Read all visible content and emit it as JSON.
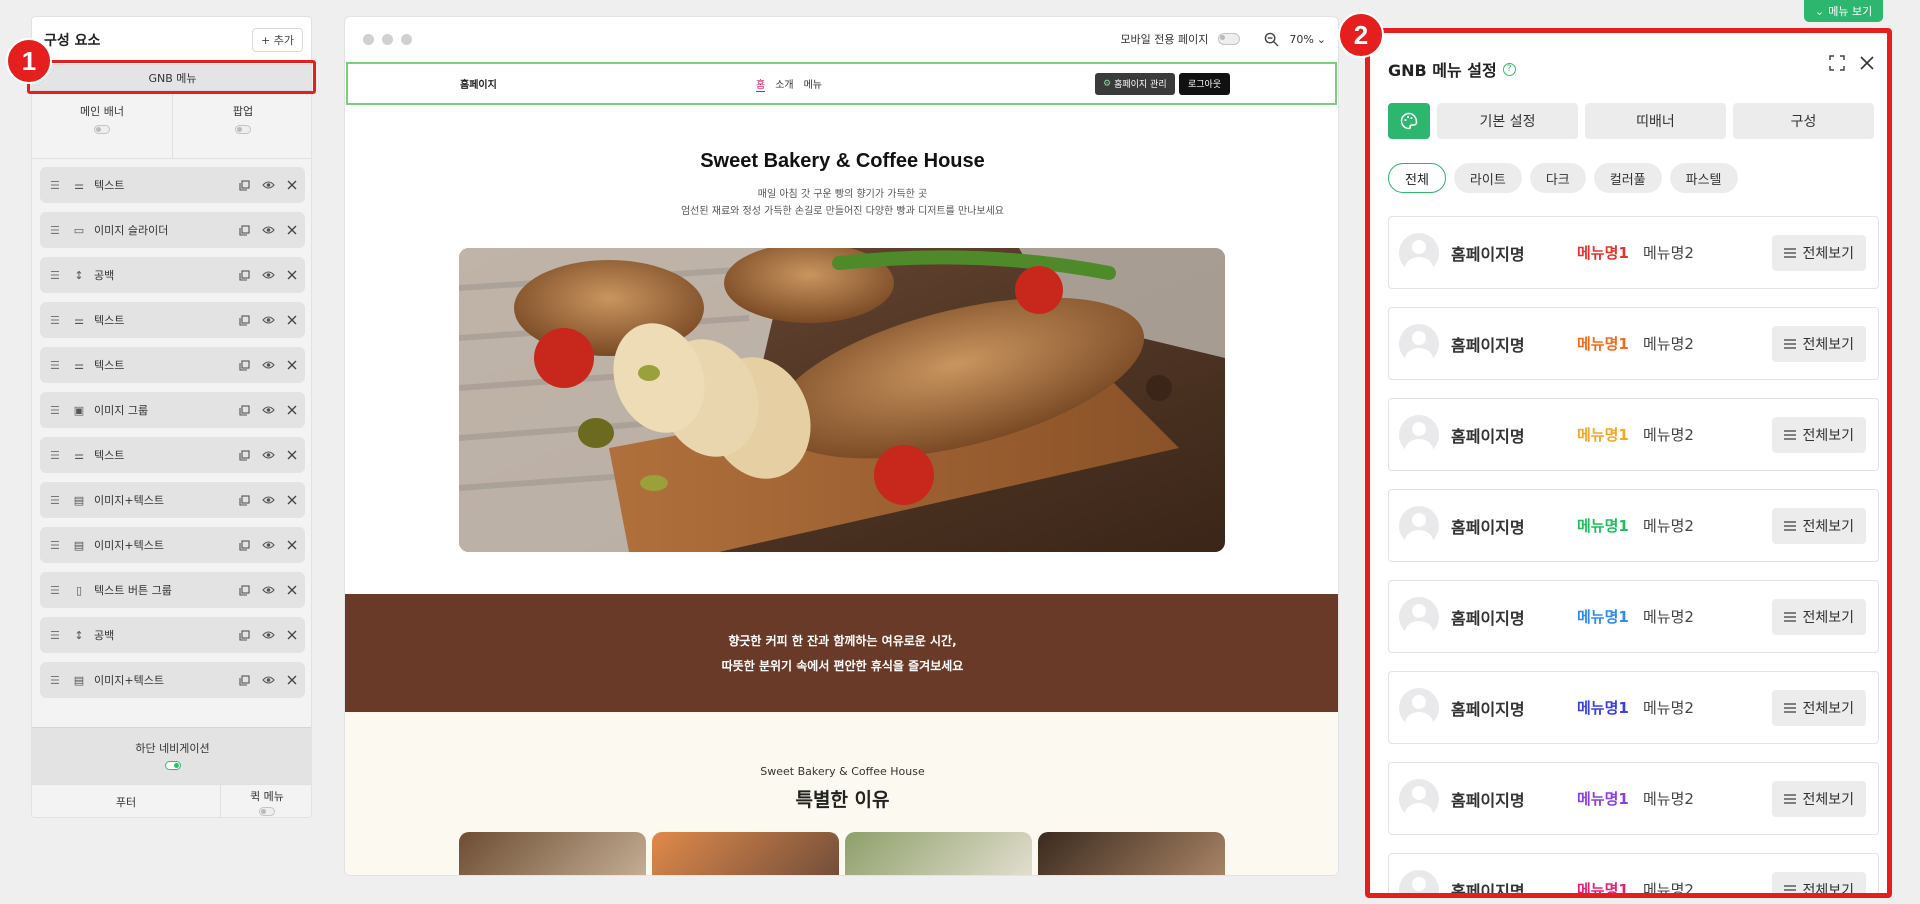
{
  "top": {
    "menu_view_label": "메뉴 보기"
  },
  "badges": {
    "one": "1",
    "two": "2"
  },
  "left_panel": {
    "title": "구성 요소",
    "add_label": "+ 추가",
    "gnb_label": "GNB 메뉴",
    "main_banner": "메인 배너",
    "popup": "팝업",
    "items": [
      {
        "label": "텍스트",
        "icon": "text-lines-icon"
      },
      {
        "label": "이미지 슬라이더",
        "icon": "slider-icon"
      },
      {
        "label": "공백",
        "icon": "spacing-icon"
      },
      {
        "label": "텍스트",
        "icon": "text-lines-icon"
      },
      {
        "label": "텍스트",
        "icon": "text-lines-icon"
      },
      {
        "label": "이미지 그룹",
        "icon": "image-group-icon"
      },
      {
        "label": "텍스트",
        "icon": "text-lines-icon"
      },
      {
        "label": "이미지+텍스트",
        "icon": "image-text-icon"
      },
      {
        "label": "이미지+텍스트",
        "icon": "image-text-icon"
      },
      {
        "label": "텍스트 버튼 그룹",
        "icon": "button-group-icon"
      },
      {
        "label": "공백",
        "icon": "spacing-icon"
      },
      {
        "label": "이미지+텍스트",
        "icon": "image-text-icon"
      }
    ],
    "bottom_nav": "하단 네비게이션",
    "footer": "푸터",
    "quick_menu": "퀵 메뉴"
  },
  "preview": {
    "mobile_only": "모바일 전용 페이지",
    "zoom": "70%",
    "gnb": {
      "logo": "홈페이지",
      "nav": [
        "홈",
        "소개",
        "메뉴"
      ],
      "admin": "홈페이지 관리",
      "logout": "로그아웃"
    },
    "hero": {
      "title": "Sweet Bakery & Coffee House",
      "sub1": "매일 아침 갓 구운 빵의 향기가 가득한 곳",
      "sub2": "엄선된 재료와 정성 가득한 손길로 만들어진 다양한 빵과 디저트를 만나보세요"
    },
    "band": {
      "line1": "향긋한 커피 한 잔과 함께하는 여유로운 시간,",
      "line2": "따뜻한 분위기 속에서 편안한 휴식을 즐겨보세요"
    },
    "section": {
      "subtitle": "Sweet Bakery & Coffee House",
      "title": "특별한 이유"
    }
  },
  "right_panel": {
    "title": "GNB 메뉴 설정",
    "help": "?",
    "tabs": [
      "기본 설정",
      "띠배너",
      "구성"
    ],
    "chips": [
      "전체",
      "라이트",
      "다크",
      "컬러풀",
      "파스텔"
    ],
    "rows": [
      {
        "name": "홈페이지명",
        "menu1": "메뉴명1",
        "menu2": "메뉴명2",
        "view_all": "전체보기",
        "accent": "#e8322c"
      },
      {
        "name": "홈페이지명",
        "menu1": "메뉴명1",
        "menu2": "메뉴명2",
        "view_all": "전체보기",
        "accent": "#f26a1b"
      },
      {
        "name": "홈페이지명",
        "menu1": "메뉴명1",
        "menu2": "메뉴명2",
        "view_all": "전체보기",
        "accent": "#f5a623"
      },
      {
        "name": "홈페이지명",
        "menu1": "메뉴명1",
        "menu2": "메뉴명2",
        "view_all": "전체보기",
        "accent": "#1fbf5f"
      },
      {
        "name": "홈페이지명",
        "menu1": "메뉴명1",
        "menu2": "메뉴명2",
        "view_all": "전체보기",
        "accent": "#2e8cf0"
      },
      {
        "name": "홈페이지명",
        "menu1": "메뉴명1",
        "menu2": "메뉴명2",
        "view_all": "전체보기",
        "accent": "#3b3fe0"
      },
      {
        "name": "홈페이지명",
        "menu1": "메뉴명1",
        "menu2": "메뉴명2",
        "view_all": "전체보기",
        "accent": "#8b3fe0"
      },
      {
        "name": "홈페이지명",
        "menu1": "메뉴명1",
        "menu2": "메뉴명2",
        "view_all": "전체보기",
        "accent": "#e6207a"
      }
    ]
  },
  "colors": {
    "accent_green": "#2cb66e",
    "highlight_red": "#e51e1e",
    "brown_band": "#6a3a28"
  }
}
